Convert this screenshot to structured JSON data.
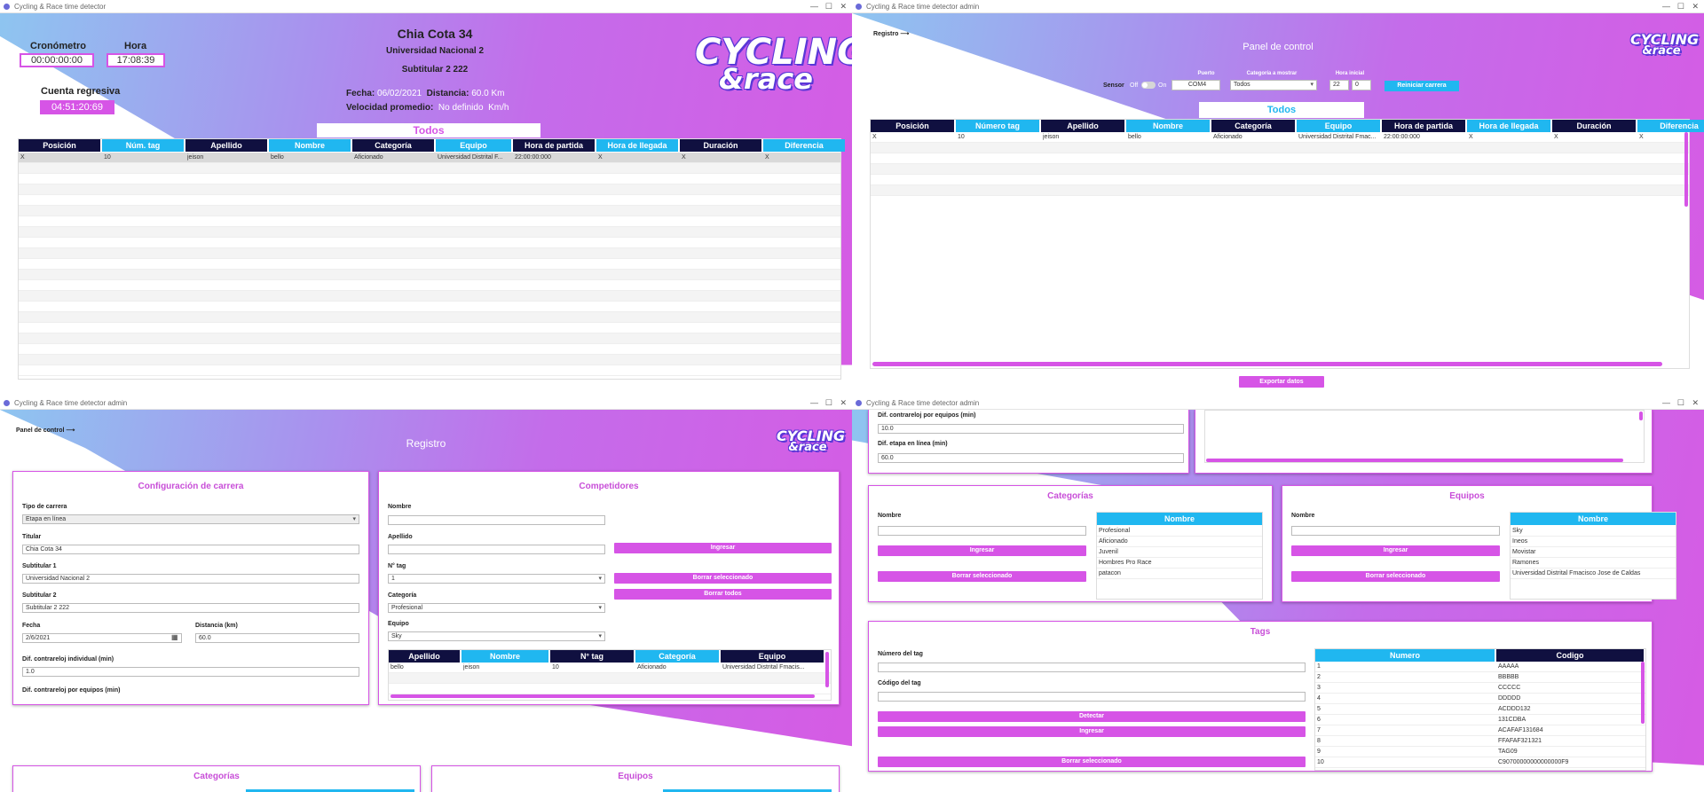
{
  "win1": {
    "title": "Cycling & Race time detector",
    "race_title": "Chia Cota 34",
    "subtitle1": "Universidad Nacional 2",
    "subtitle2": "Subtitular 2  222",
    "cronometro_label": "Cronómetro",
    "cronometro_value": "00:00:00:00",
    "hora_label": "Hora",
    "hora_value": "17:08:39",
    "cuenta_label": "Cuenta regresiva",
    "cuenta_value": "04:51:20:69",
    "fecha_label": "Fecha:",
    "fecha_value": "06/02/2021",
    "distancia_label": "Distancia:",
    "distancia_value": "60.0",
    "distancia_unit": "Km",
    "velocidad_label": "Velocidad promedio:",
    "velocidad_value": "No definido",
    "velocidad_unit": "Km/h",
    "tab": "Todos",
    "headers": [
      "Posición",
      "Núm. tag",
      "Apellido",
      "Nombre",
      "Categoría",
      "Equipo",
      "Hora de partida",
      "Hora de llegada",
      "Duración",
      "Diferencia"
    ],
    "rows": [
      [
        "X",
        "10",
        "jeison",
        "bello",
        "Aficionado",
        "Universidad Distrital F...",
        "22:00:00:000",
        "X",
        "X",
        "X"
      ]
    ]
  },
  "win2": {
    "title": "Cycling & Race time detector admin",
    "nav": "Registro",
    "heading": "Panel de control",
    "sensor_label": "Sensor",
    "sensor_off": "Off",
    "sensor_on": "On",
    "puerto_label": "Puerto",
    "puerto_value": "COM4",
    "categoria_label": "Categoría a mostrar",
    "categoria_value": "Todos",
    "hora_label": "Hora inicial",
    "hora_h": "22",
    "hora_m": "0",
    "reiniciar": "Reiniciar carrera",
    "tab": "Todos",
    "exportar": "Exportar datos",
    "headers": [
      "Posición",
      "Número tag",
      "Apellido",
      "Nombre",
      "Categoría",
      "Equipo",
      "Hora de partida",
      "Hora de llegada",
      "Duración",
      "Diferencia"
    ],
    "rows": [
      [
        "X",
        "10",
        "jeison",
        "bello",
        "Aficionado",
        "Universidad Distrital Fmac...",
        "22:00:00:000",
        "X",
        "X",
        "X"
      ]
    ]
  },
  "win3": {
    "title": "Cycling & Race time detector admin",
    "nav": "Panel de control",
    "heading": "Registro",
    "config": {
      "title": "Configuración de carrera",
      "tipo_label": "Tipo de carrera",
      "tipo_value": "Etapa en línea",
      "titular_label": "Titular",
      "titular_value": "Chia Cota 34",
      "sub1_label": "Subtitular 1",
      "sub1_value": "Universidad Nacional 2",
      "sub2_label": "Subtitular 2",
      "sub2_value": "Subtitular 2  222",
      "fecha_label": "Fecha",
      "fecha_value": "2/6/2021",
      "dist_label": "Distancia (km)",
      "dist_value": "60.0",
      "ind_label": "Dif. contrareloj individual (min)",
      "ind_value": "1.0",
      "eq_label": "Dif. contrareloj por equipos (min)",
      "eq_value": "10.0",
      "linea_label": "Dif. etapa en línea (min)",
      "linea_value": "60.0"
    },
    "comp": {
      "title": "Competidores",
      "nombre_label": "Nombre",
      "apellido_label": "Apellido",
      "tag_label": "N° tag",
      "tag_value": "1",
      "cat_label": "Categoría",
      "cat_value": "Profesional",
      "equipo_label": "Equipo",
      "equipo_value": "Sky",
      "ingresar": "Ingresar",
      "borrar_sel": "Borrar seleccionado",
      "borrar_todos": "Borrar todos",
      "headers": [
        "Apellido",
        "Nombre",
        "N° tag",
        "Categoría",
        "Equipo"
      ],
      "rows": [
        [
          "bello",
          "jeison",
          "10",
          "Aficionado",
          "Universidad Distrital Fmacis..."
        ]
      ]
    },
    "categorias_title": "Categorías",
    "equipos_title": "Equipos"
  },
  "win4": {
    "title": "Cycling & Race time detector admin",
    "eq_label": "Dif. contrareloj por equipos (min)",
    "eq_value": "10.0",
    "linea_label": "Dif. etapa en línea (min)",
    "linea_value": "60.0",
    "categorias": {
      "title": "Categorías",
      "nombre_label": "Nombre",
      "ingresar": "Ingresar",
      "borrar": "Borrar seleccionado",
      "header": "Nombre",
      "items": [
        "Profesional",
        "Aficionado",
        "Juvenil",
        "Hombres Pro Race",
        "patacon"
      ]
    },
    "equipos": {
      "title": "Equipos",
      "nombre_label": "Nombre",
      "ingresar": "Ingresar",
      "borrar": "Borrar seleccionado",
      "header": "Nombre",
      "items": [
        "Sky",
        "Ineos",
        "Movistar",
        "Ramones",
        "Universidad Distrital Fmacisco Jose de Caldas"
      ]
    },
    "tags": {
      "title": "Tags",
      "numero_label": "Número del tag",
      "codigo_label": "Código del tag",
      "detectar": "Detectar",
      "ingresar": "Ingresar",
      "borrar": "Borrar seleccionado",
      "h_num": "Numero",
      "h_cod": "Codigo",
      "rows": [
        [
          "1",
          "AAAAA"
        ],
        [
          "2",
          "BBBBB"
        ],
        [
          "3",
          "CCCCC"
        ],
        [
          "4",
          "DDDDD"
        ],
        [
          "5",
          "ACDDD132"
        ],
        [
          "6",
          "131CDBA"
        ],
        [
          "7",
          "ACAFAF131684"
        ],
        [
          "8",
          "FFAFAF321321"
        ],
        [
          "9",
          "TAG09"
        ],
        [
          "10",
          "C90700000000000000F9"
        ]
      ]
    }
  },
  "logo": {
    "line1": "CYCLING",
    "line2": "&race"
  },
  "colors": {
    "accent": "#d654e6",
    "header_dark": "#101040",
    "header_light": "#20b7f0"
  }
}
